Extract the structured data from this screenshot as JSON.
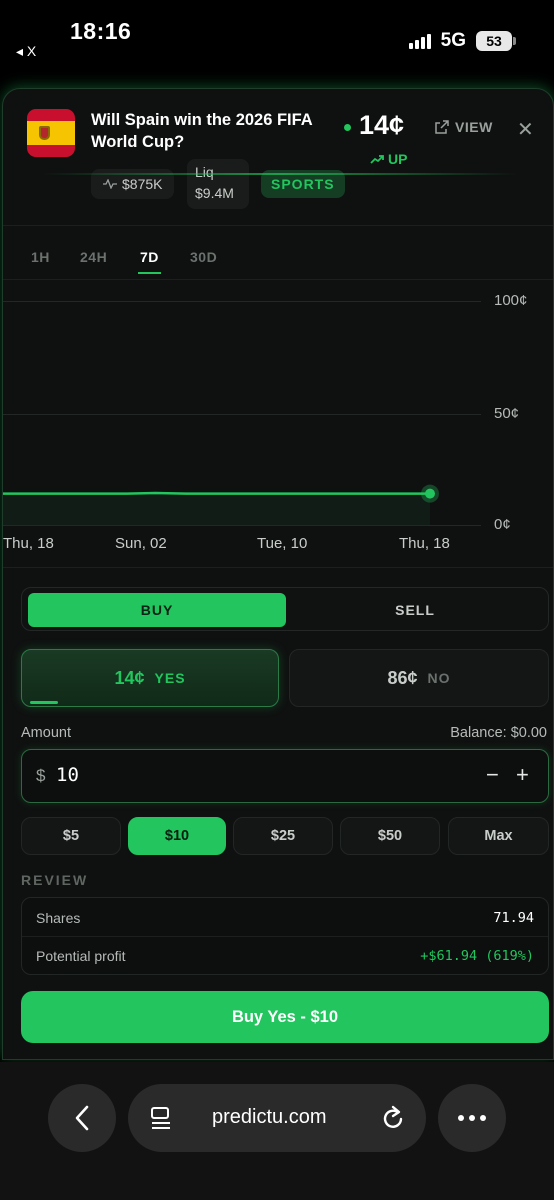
{
  "status_bar": {
    "time": "18:16",
    "back_label": "◂ X",
    "network": "5G",
    "battery": "53"
  },
  "market": {
    "title": "Will Spain win the 2026 FIFA World Cup?",
    "price": "14¢",
    "trend": "UP",
    "view_label": "VIEW",
    "volume": "$875K",
    "liq_label": "Liq",
    "liq_value": "$9.4M",
    "category": "SPORTS"
  },
  "time_tabs": [
    {
      "label": "1H",
      "active": false
    },
    {
      "label": "24H",
      "active": false
    },
    {
      "label": "7D",
      "active": true
    },
    {
      "label": "30D",
      "active": false
    }
  ],
  "chart_data": {
    "type": "line",
    "x_ticks": [
      "Thu, 18",
      "Sun, 02",
      "Tue, 10",
      "Thu, 18"
    ],
    "y_ticks": [
      "100¢",
      "50¢",
      "0¢"
    ],
    "ylim": [
      0,
      100
    ],
    "grid": true,
    "series": [
      {
        "color": "#22c55e",
        "values": [
          14,
          14,
          14,
          14,
          14,
          14.3,
          14,
          14,
          14,
          14,
          14,
          14,
          14,
          14,
          14
        ]
      }
    ]
  },
  "trade": {
    "buy_label": "BUY",
    "sell_label": "SELL",
    "yes_price": "14¢",
    "yes_label": "YES",
    "no_price": "86¢",
    "no_label": "NO",
    "amount_label": "Amount",
    "balance": "Balance: $0.00",
    "currency": "$",
    "amount": "10",
    "minus": "−",
    "plus": "+",
    "presets": [
      {
        "label": "$5",
        "active": false
      },
      {
        "label": "$10",
        "active": true
      },
      {
        "label": "$25",
        "active": false
      },
      {
        "label": "$50",
        "active": false
      },
      {
        "label": "Max",
        "active": false
      }
    ],
    "review_title": "REVIEW",
    "shares_label": "Shares",
    "shares_value": "71.94",
    "profit_label": "Potential profit",
    "profit_value": "+$61.94 (619%)",
    "cta": "Buy Yes - $10"
  },
  "browser": {
    "url": "predictu.com"
  },
  "colors": {
    "accent": "#22c55e",
    "background": "#0f1110"
  }
}
